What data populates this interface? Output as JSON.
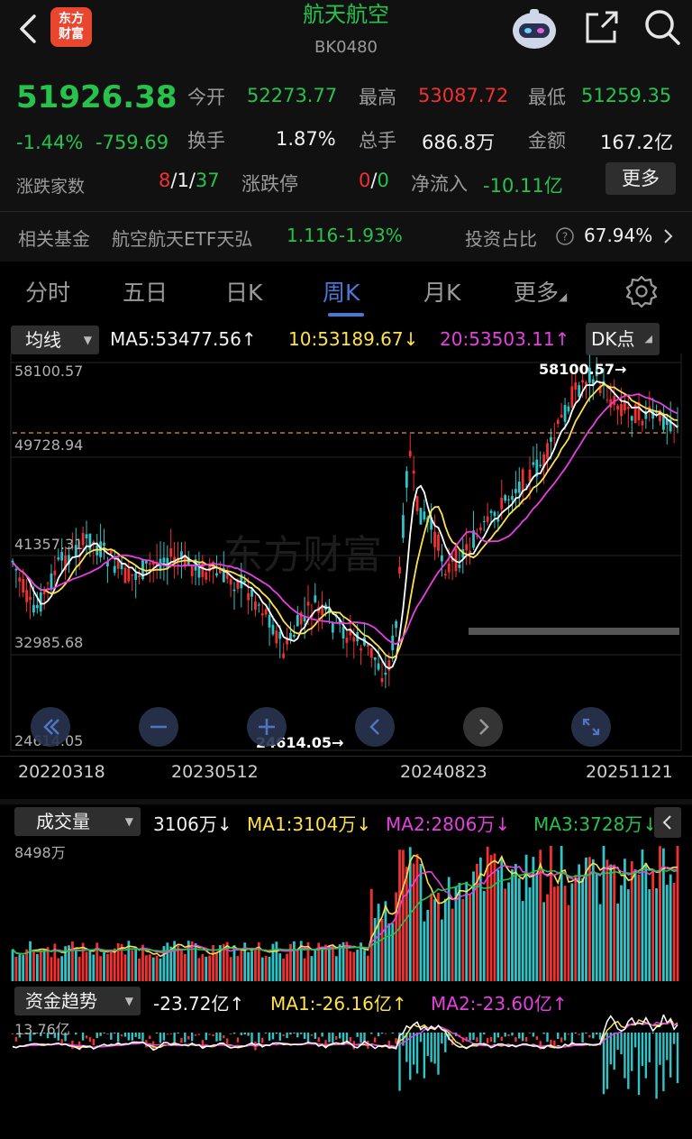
{
  "header": {
    "logo_line1": "东方",
    "logo_line2": "财富",
    "title": "航天航空",
    "code": "BK0480"
  },
  "quote": {
    "price": "51926.38",
    "change_pct": "-1.44%",
    "change_amt": "-759.69",
    "open_label": "今开",
    "open": "52273.77",
    "high_label": "最高",
    "high": "53087.72",
    "low_label": "最低",
    "low": "51259.35",
    "turnover_label": "换手",
    "turnover": "1.87%",
    "volume_label": "总手",
    "volume": "686.8万",
    "amount_label": "金额",
    "amount": "167.2亿",
    "breadth_label": "涨跌家数",
    "breadth_up": "8",
    "breadth_sep1": "/",
    "breadth_flat": "1",
    "breadth_sep2": "/",
    "breadth_down": "37",
    "limit_label": "涨跌停",
    "limit_up": "0",
    "limit_sep": "/",
    "limit_down": "0",
    "netflow_label": "净流入",
    "netflow": "-10.11亿",
    "more_label": "更多"
  },
  "fund": {
    "label": "相关基金",
    "name": "航空航天ETF天弘",
    "price": "1.116",
    "change": "-1.93%",
    "ratio_label": "投资占比",
    "ratio": "67.94%"
  },
  "tabs": [
    "分时",
    "五日",
    "日K",
    "周K",
    "月K",
    "更多"
  ],
  "ma_bar": {
    "selector": "均线",
    "ma5": "MA5:53477.56",
    "ma5_arrow": "↑",
    "ma10": "10:53189.67",
    "ma10_arrow": "↓",
    "ma20": "20:53503.11",
    "ma20_arrow": "↑",
    "dk": "DK点"
  },
  "kchart_labels": {
    "y_top": "58100.57",
    "y_2": "49728.94",
    "y_3": "41357.31",
    "y_4": "32985.68",
    "y_bottom": "24614.05",
    "max_mark": "58100.57→",
    "min_mark": "24614.05→",
    "watermark": "东方财富"
  },
  "dates": [
    "20220318",
    "20230512",
    "20240823",
    "20251121"
  ],
  "volume_bar": {
    "selector": "成交量",
    "current": "3106万",
    "current_arrow": "↓",
    "ma1": "MA1:3104万",
    "ma1_arrow": "↓",
    "ma2": "MA2:2806万",
    "ma2_arrow": "↓",
    "ma3": "MA3:3728万",
    "ma3_arrow": "↓",
    "max": "8498万"
  },
  "fund_bar": {
    "selector": "资金趋势",
    "current": "-23.72亿",
    "current_arrow": "↑",
    "ma1": "MA1:-26.16亿",
    "ma1_arrow": "↑",
    "ma2": "MA2:-23.60亿",
    "ma2_arrow": "↑",
    "max": "13.76亿"
  },
  "colors": {
    "up": "#f23030",
    "down": "#27c24c",
    "bar_down": "#2ec4c8",
    "ma5": "#ffffff",
    "ma10": "#ffe14a",
    "ma20": "#e540e0",
    "accent": "#4a78d8"
  }
}
